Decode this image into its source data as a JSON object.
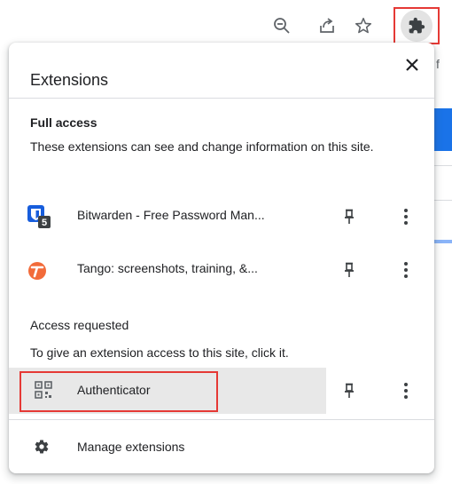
{
  "toolbar": {
    "zoom_icon": "zoom-out-icon",
    "share_icon": "share-icon",
    "bookmark_icon": "star-icon",
    "extensions_icon": "puzzle-piece-icon"
  },
  "background": {
    "edge_char": "f"
  },
  "popup": {
    "title": "Extensions",
    "close_icon": "close-icon",
    "full_access": {
      "heading": "Full access",
      "description": "These extensions can see and change information on this site.",
      "items": [
        {
          "name": "Bitwarden - Free Password Man...",
          "icon": "bitwarden-icon",
          "badge": "5"
        },
        {
          "name": "Tango: screenshots, training, &...",
          "icon": "tango-icon"
        }
      ]
    },
    "access_requested": {
      "heading": "Access requested",
      "description": "To give an extension access to this site, click it.",
      "items": [
        {
          "name": "Authenticator",
          "icon": "qr-code-icon"
        }
      ]
    },
    "manage": {
      "label": "Manage extensions",
      "icon": "gear-icon"
    }
  },
  "colors": {
    "highlight_border": "#e53935",
    "bitwarden_blue": "#175ddc",
    "tango_orange": "#f26b3a"
  }
}
